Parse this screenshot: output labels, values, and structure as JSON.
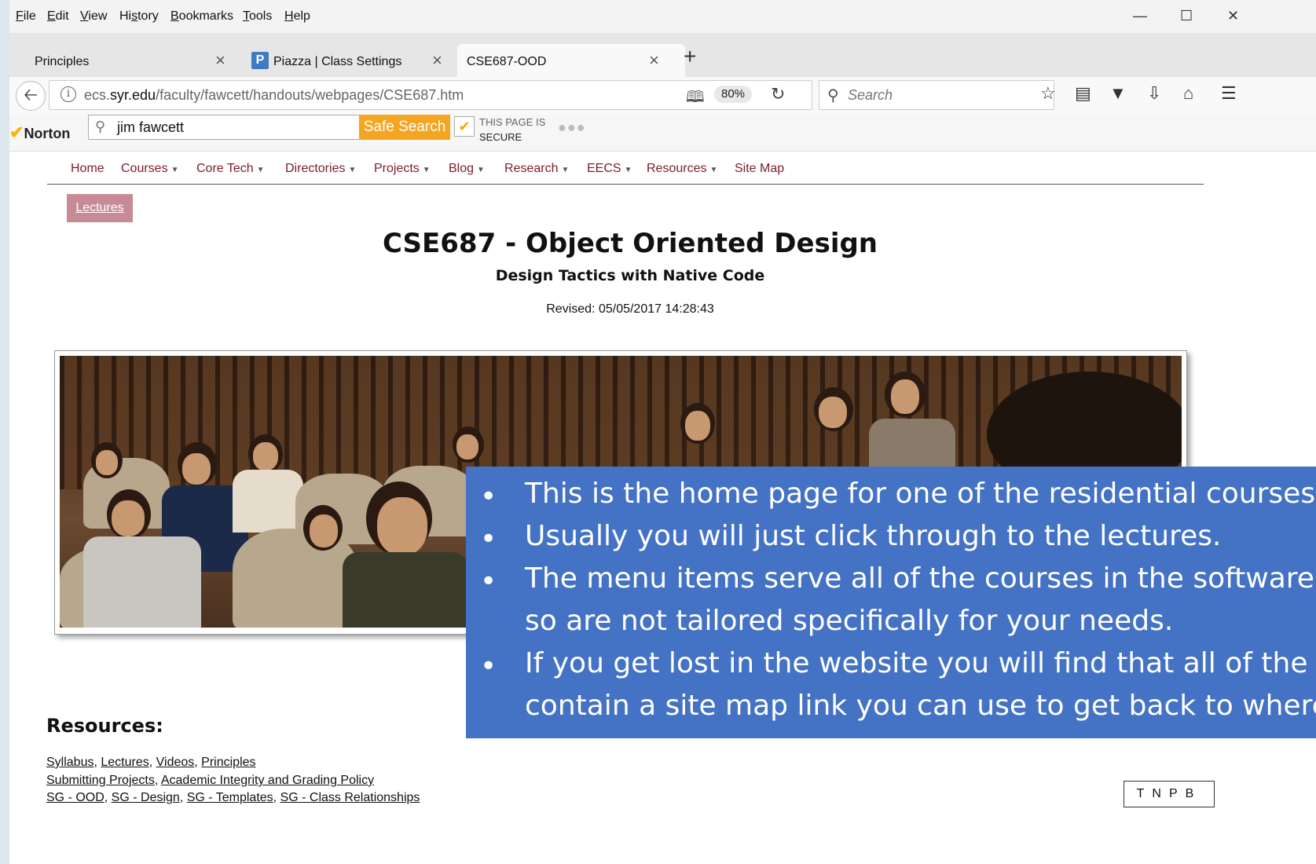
{
  "menubar": {
    "items": [
      {
        "pre": "",
        "key": "F",
        "post": "ile"
      },
      {
        "pre": "",
        "key": "E",
        "post": "dit"
      },
      {
        "pre": "",
        "key": "V",
        "post": "iew"
      },
      {
        "pre": "Hi",
        "key": "s",
        "post": "tory"
      },
      {
        "pre": "",
        "key": "B",
        "post": "ookmarks"
      },
      {
        "pre": "",
        "key": "T",
        "post": "ools"
      },
      {
        "pre": "",
        "key": "H",
        "post": "elp"
      }
    ]
  },
  "tabs": [
    {
      "label": "Principles"
    },
    {
      "label": "Piazza | Class Settings",
      "icon_letter": "P"
    },
    {
      "label": "CSE687-OOD"
    }
  ],
  "navbar": {
    "url_pre": "ecs.",
    "url_domain": "syr.edu",
    "url_post": "/faculty/fawcett/handouts/webpages/CSE687.htm",
    "zoom": "80%",
    "search_placeholder": "Search"
  },
  "norton": {
    "brand": "Norton",
    "search_value": "jim fawcett",
    "safe_search_label": "Safe Search",
    "secure_line1": "THIS PAGE IS",
    "secure_line2": "SECURE"
  },
  "site_nav": [
    {
      "label": "Home",
      "dropdown": false
    },
    {
      "label": "Courses",
      "dropdown": true
    },
    {
      "label": "Core Tech",
      "dropdown": true
    },
    {
      "label": "Directories",
      "dropdown": true
    },
    {
      "label": "Projects",
      "dropdown": true
    },
    {
      "label": "Blog",
      "dropdown": true
    },
    {
      "label": "Research",
      "dropdown": true
    },
    {
      "label": "EECS",
      "dropdown": true
    },
    {
      "label": "Resources",
      "dropdown": true
    },
    {
      "label": "Site Map",
      "dropdown": false
    }
  ],
  "page": {
    "lectures_button": "Lectures",
    "title": "CSE687 - Object Oriented Design",
    "subtitle": "Design Tactics with Native Code",
    "revised": "Revised: 05/05/2017 14:28:43",
    "resources_heading": "Resources:",
    "resource_lines": [
      [
        "Syllabus",
        "Lectures",
        "Videos",
        "Principles"
      ],
      [
        "Submitting Projects",
        "Academic Integrity and Grading Policy"
      ],
      [
        "SG - OOD",
        "SG - Design",
        "SG - Templates",
        "SG - Class Relationships"
      ]
    ],
    "corner_nav": "TNPB"
  },
  "overlay": {
    "bullet": "•",
    "lines": [
      {
        "text": "This is the home page for one of the residential courses.",
        "bullet": true
      },
      {
        "text": "Usually you will just click through to the lectures.",
        "bullet": true
      },
      {
        "text": "The menu items serve all of the courses in the software program,",
        "bullet": true
      },
      {
        "text": "so are not tailored specifically for your needs.",
        "bullet": false
      },
      {
        "text": "If you get lost in the website you will find that all of the pages",
        "bullet": true
      },
      {
        "text": "contain a site map link you can use to get back to where you want to be.",
        "bullet": false
      }
    ]
  },
  "colors": {
    "nav_link": "#7b1c2a",
    "lectures_button_bg": "#c78b96",
    "safe_search_bg": "#f4a522",
    "overlay_bg": "#4472c4"
  }
}
